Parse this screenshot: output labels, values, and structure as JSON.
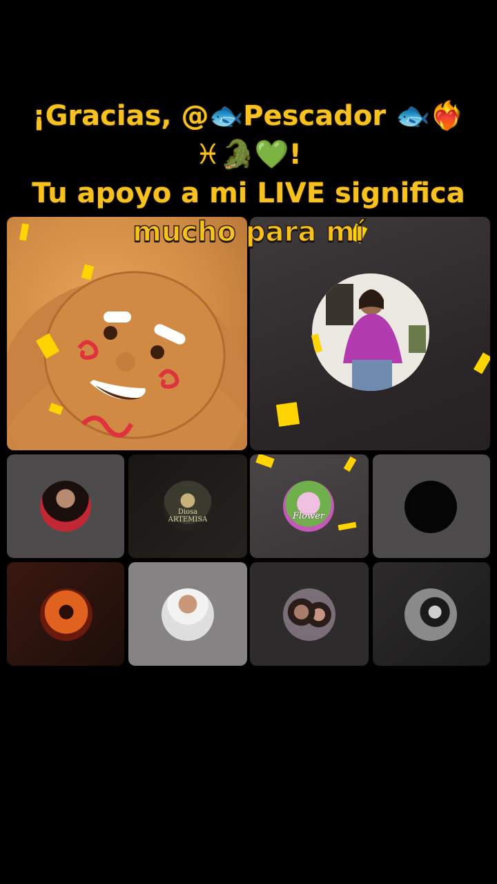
{
  "banner": {
    "line1": "¡Gracias, @🐟Pescador 🐟❤️‍🔥",
    "line2": "♓🐊💚!",
    "line3": "Tu apoyo a mi LIVE significa",
    "line4": "mucho para mí"
  },
  "guests": [
    {
      "avatar_text": "Diosa ARTEMISA"
    },
    {
      "avatar_text": "Flower"
    }
  ]
}
